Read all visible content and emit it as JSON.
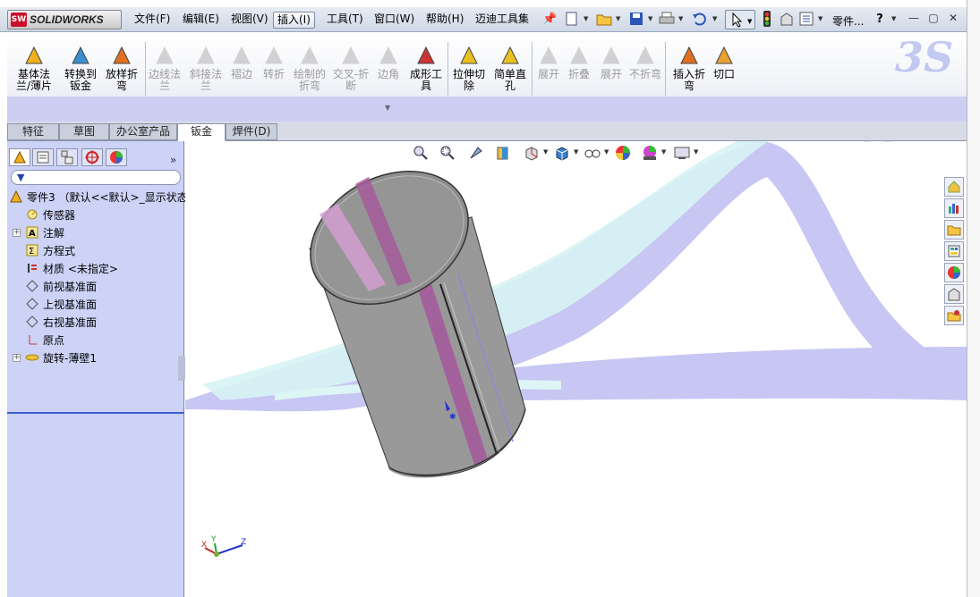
{
  "app": {
    "logo_text": "SOLIDWORKS",
    "logo_badge": "SW"
  },
  "menu": {
    "items": [
      {
        "label": "文件(F)"
      },
      {
        "label": "编辑(E)"
      },
      {
        "label": "视图(V)"
      },
      {
        "label": "插入(I)",
        "active": true
      },
      {
        "label": "工具(T)"
      },
      {
        "label": "窗口(W)"
      },
      {
        "label": "帮助(H)"
      },
      {
        "label": "迈迪工具集"
      }
    ],
    "part_label": "零件...",
    "help_label": "?"
  },
  "ribbon": {
    "buttons": [
      {
        "label": "基体法\n兰/薄片",
        "enabled": true,
        "icon": "base-flange-icon"
      },
      {
        "label": "转换到\n钣金",
        "enabled": true,
        "icon": "convert-to-sheetmetal-icon"
      },
      {
        "label": "放样折\n弯",
        "enabled": true,
        "icon": "lofted-bend-icon"
      },
      {
        "label": "边线法\n兰",
        "enabled": false,
        "icon": "edge-flange-icon"
      },
      {
        "label": "斜接法\n兰",
        "enabled": false,
        "icon": "miter-flange-icon"
      },
      {
        "label": "褶边",
        "enabled": false,
        "icon": "hem-icon"
      },
      {
        "label": "转折",
        "enabled": false,
        "icon": "jog-icon"
      },
      {
        "label": "绘制的\n折弯",
        "enabled": false,
        "icon": "sketched-bend-icon"
      },
      {
        "label": "交叉-折\n断",
        "enabled": false,
        "icon": "cross-break-icon"
      },
      {
        "label": "边角",
        "enabled": false,
        "icon": "corner-icon"
      },
      {
        "label": "成形工\n具",
        "enabled": true,
        "icon": "forming-tool-icon"
      },
      {
        "label": "拉伸切\n除",
        "enabled": true,
        "icon": "extruded-cut-icon"
      },
      {
        "label": "简单直\n孔",
        "enabled": true,
        "icon": "simple-hole-icon"
      },
      {
        "label": "展开",
        "enabled": false,
        "icon": "unfold-icon"
      },
      {
        "label": "折叠",
        "enabled": false,
        "icon": "fold-icon"
      },
      {
        "label": "展开",
        "enabled": false,
        "icon": "flatten-icon"
      },
      {
        "label": "不折弯",
        "enabled": false,
        "icon": "no-bends-icon"
      },
      {
        "label": "插入折\n弯",
        "enabled": true,
        "icon": "insert-bends-icon"
      },
      {
        "label": "切口",
        "enabled": true,
        "icon": "rip-icon"
      }
    ]
  },
  "tabs": [
    {
      "label": "特征"
    },
    {
      "label": "草图"
    },
    {
      "label": "办公室产品"
    },
    {
      "label": "钣金(H)",
      "active": true
    },
    {
      "label": "焊件(D)"
    }
  ],
  "tree": {
    "root": "零件3 （默认<<默认>_显示状态",
    "items": [
      {
        "label": "传感器",
        "icon": "sensor-icon",
        "expandable": false
      },
      {
        "label": "注解",
        "icon": "annotation-icon",
        "expandable": true
      },
      {
        "label": "方程式",
        "icon": "equation-icon",
        "expandable": false
      },
      {
        "label": "材质 <未指定>",
        "icon": "material-icon",
        "expandable": false
      },
      {
        "label": "前视基准面",
        "icon": "plane-icon",
        "expandable": false
      },
      {
        "label": "上视基准面",
        "icon": "plane-icon",
        "expandable": false
      },
      {
        "label": "右视基准面",
        "icon": "plane-icon",
        "expandable": false
      },
      {
        "label": "原点",
        "icon": "origin-icon",
        "expandable": false
      },
      {
        "label": "旋转-薄壁1",
        "icon": "revolve-thin-icon",
        "expandable": true
      }
    ]
  },
  "triad": {
    "x": "X",
    "y": "Y",
    "z": "Z"
  },
  "colors": {
    "accent": "#3a5fd0",
    "panel": "#ccd3f7",
    "cylinder": "#9c9c9c",
    "stripe": "#a65a9e",
    "background_swirl": "#c9c7f3"
  }
}
